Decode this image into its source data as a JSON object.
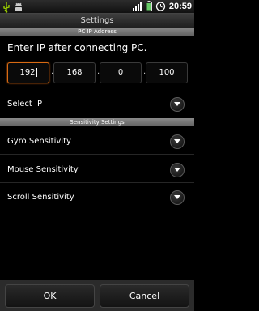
{
  "status_bar": {
    "time": "20:59",
    "icons": [
      "usb-icon",
      "android-debug-icon",
      "signal-icon",
      "battery-icon",
      "alarm-icon"
    ]
  },
  "title": "Settings",
  "pc_ip_section": {
    "header": "PC IP Address",
    "instruction": "Enter IP after connecting PC.",
    "ip_octets": [
      "192",
      "168",
      "0",
      "100"
    ]
  },
  "select_ip": {
    "label": "Select IP"
  },
  "sensitivity_section": {
    "header": "Sensitivity Settings",
    "items": [
      {
        "label": "Gyro Sensitivity"
      },
      {
        "label": "Mouse Sensitivity"
      },
      {
        "label": "Scroll Sensitivity"
      }
    ]
  },
  "buttons": {
    "ok": "OK",
    "cancel": "Cancel"
  },
  "colors": {
    "accent": "#d86a13",
    "section_header": "#7a7a7a",
    "background": "#000000"
  }
}
